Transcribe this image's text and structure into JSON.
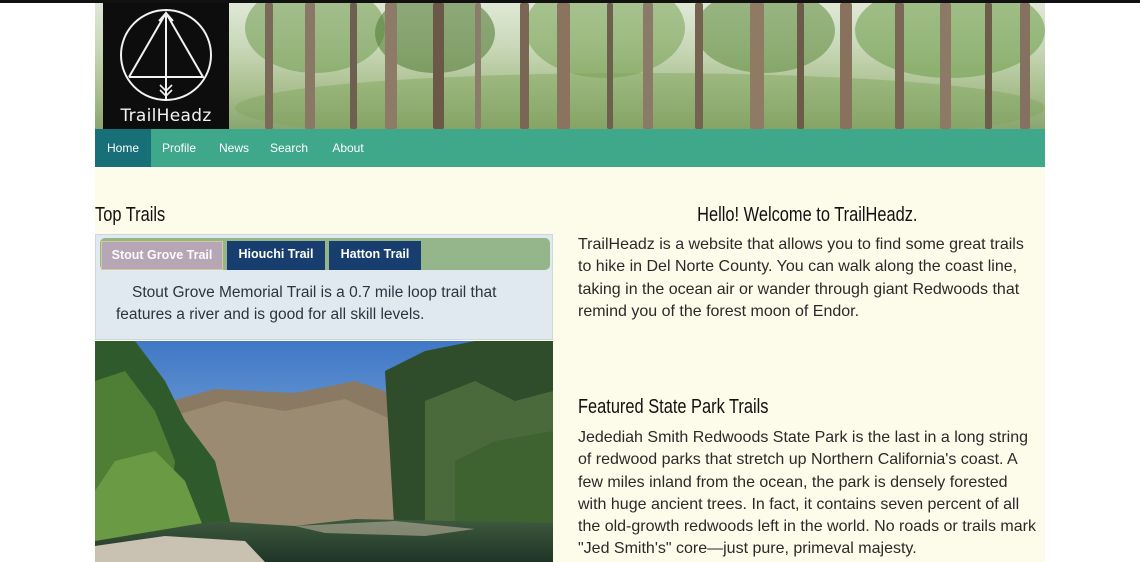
{
  "brand": {
    "name": "TrailHeadz"
  },
  "nav": {
    "items": [
      {
        "label": "Home",
        "active": true
      },
      {
        "label": "Profile",
        "active": false
      },
      {
        "label": "News",
        "active": false
      },
      {
        "label": "Search",
        "active": false
      },
      {
        "label": "About",
        "active": false
      }
    ]
  },
  "top_trails": {
    "heading": "Top Trails",
    "tabs": [
      {
        "label": "Stout Grove Trail",
        "selected": true
      },
      {
        "label": "Hiouchi Trail",
        "selected": false
      },
      {
        "label": "Hatton Trail",
        "selected": false
      }
    ],
    "content": "Stout Grove Memorial Trail is a 0.7 mile loop trail that features a river and is good for all skill levels."
  },
  "welcome": {
    "heading": "Hello! Welcome to TrailHeadz.",
    "text": "TrailHeadz is a website that allows you to find some great trails to hike in Del Norte County. You can walk along the coast line, taking in the ocean air or wander through giant Redwoods that remind you of the forest moon of Endor."
  },
  "featured": {
    "heading": "Featured State Park Trails",
    "text": "Jedediah Smith Redwoods State Park is the last in a long string of redwood parks that stretch up Northern California's coast. A few miles inland from the ocean, the park is densely forested with huge ancient trees. In fact, it contains seven percent of all the old-growth redwoods left in the world. No roads or trails mark \"Jed Smith's\" core—just pure, primeval majesty."
  },
  "colors": {
    "nav_bg": "#3fa88a",
    "nav_active": "#176f78",
    "tab_selected": "#b7a6b5",
    "tab_default": "#173e6e",
    "tabbar_bg": "#94b68a",
    "page_bg": "#fdfbe9"
  },
  "icons": {
    "logo": "arrow-triangle-circle-logo-icon"
  }
}
